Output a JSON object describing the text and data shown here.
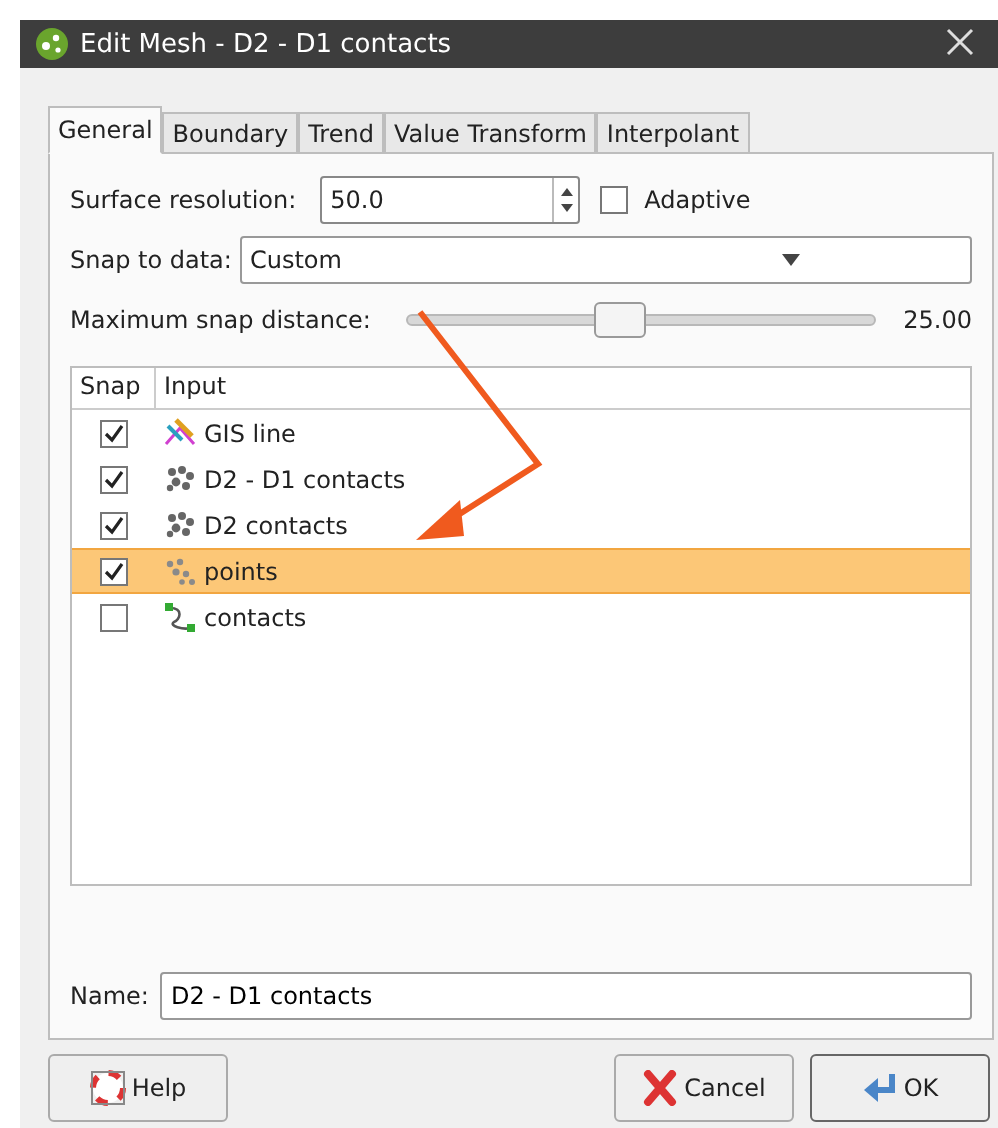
{
  "window": {
    "title": "Edit Mesh - D2 - D1 contacts"
  },
  "tabs": [
    {
      "label": "General",
      "selected": true
    },
    {
      "label": "Boundary",
      "selected": false
    },
    {
      "label": "Trend",
      "selected": false
    },
    {
      "label": "Value Transform",
      "selected": false
    },
    {
      "label": "Interpolant",
      "selected": false
    }
  ],
  "surface_resolution": {
    "label": "Surface resolution:",
    "value": "50.0"
  },
  "adaptive": {
    "label": "Adaptive",
    "checked": false
  },
  "snap_to_data": {
    "label": "Snap to data:",
    "value": "Custom"
  },
  "max_snap_distance": {
    "label": "Maximum snap distance:",
    "level": 0.45,
    "reading": "25.00"
  },
  "table": {
    "columns": [
      "Snap",
      "Input"
    ],
    "rows": [
      {
        "kind": "gis_line",
        "name": "GIS line",
        "checked": true,
        "selected": false
      },
      {
        "kind": "mesh_points",
        "name": "D2 - D1 contacts",
        "checked": true,
        "selected": false
      },
      {
        "kind": "mesh_points",
        "name": "D2 contacts",
        "checked": true,
        "selected": false
      },
      {
        "kind": "points",
        "name": "points",
        "checked": true,
        "selected": true
      },
      {
        "kind": "polyline",
        "name": "contacts",
        "checked": false,
        "selected": false
      }
    ]
  },
  "name_field": {
    "label": "Name:",
    "value": "D2 - D1 contacts"
  },
  "buttons": [
    {
      "kind": "help",
      "label": "Help"
    },
    {
      "kind": "cancel",
      "label": "Cancel"
    },
    {
      "kind": "ok",
      "label": "OK"
    }
  ]
}
